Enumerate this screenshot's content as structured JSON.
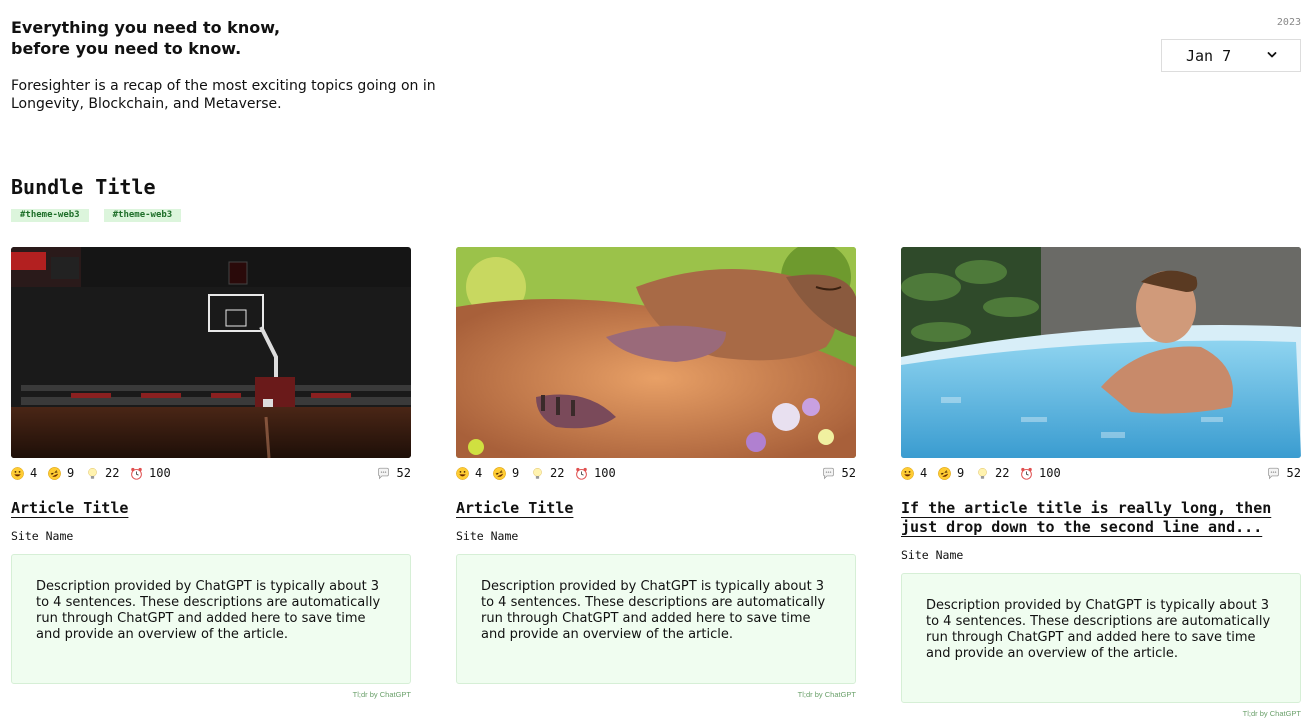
{
  "hero": {
    "title_line1": "Everything you need to know,",
    "title_line2": "before you need to know.",
    "description": "Foresighter is a recap of the most exciting topics going on in Longevity, Blockchain, and Metaverse."
  },
  "date_picker": {
    "year": "2023",
    "selected": "Jan 7"
  },
  "bundle": {
    "title": "Bundle Title",
    "tags": [
      "#theme-web3",
      "#theme-web3"
    ]
  },
  "cards": [
    {
      "image": "basketball-court-photo",
      "reactions": {
        "smile": "4",
        "laugh": "9",
        "idea": "22",
        "alarm": "100",
        "comments": "52"
      },
      "title": "Article Title",
      "site": "Site Name",
      "description": "Description provided by ChatGPT is typically about 3 to 4 sentences. These descriptions are automatically run through ChatGPT and added here to save time and provide an overview of the article.",
      "tldr": "Tl;dr by ChatGPT"
    },
    {
      "image": "capybara-painting",
      "reactions": {
        "smile": "4",
        "laugh": "9",
        "idea": "22",
        "alarm": "100",
        "comments": "52"
      },
      "title": "Article Title",
      "site": "Site Name",
      "description": "Description provided by ChatGPT is typically about 3 to 4 sentences. These descriptions are automatically run through ChatGPT and added here to save time and provide an overview of the article.",
      "tldr": "Tl;dr by ChatGPT"
    },
    {
      "image": "man-in-ice-bath-photo",
      "reactions": {
        "smile": "4",
        "laugh": "9",
        "idea": "22",
        "alarm": "100",
        "comments": "52"
      },
      "title": "If the article title is really long, then just drop down to the second line and...",
      "site": "Site Name",
      "description": "Description provided by ChatGPT is typically about 3 to 4 sentences. These descriptions are automatically run through ChatGPT and added here to save time and provide an overview of the article.",
      "tldr": "Tl;dr by ChatGPT"
    }
  ],
  "icons": {
    "smile": "grinning-face-icon",
    "laugh": "rolling-laughing-icon",
    "idea": "light-bulb-icon",
    "alarm": "alarm-clock-icon",
    "comments": "speech-bubble-icon",
    "dropdown": "chevron-down-icon"
  },
  "colors": {
    "tag_bg": "#dcf5dc",
    "tag_text": "#1f6f2a",
    "desc_bg": "#f0fdf0",
    "tldr_text": "#6aa06a"
  }
}
